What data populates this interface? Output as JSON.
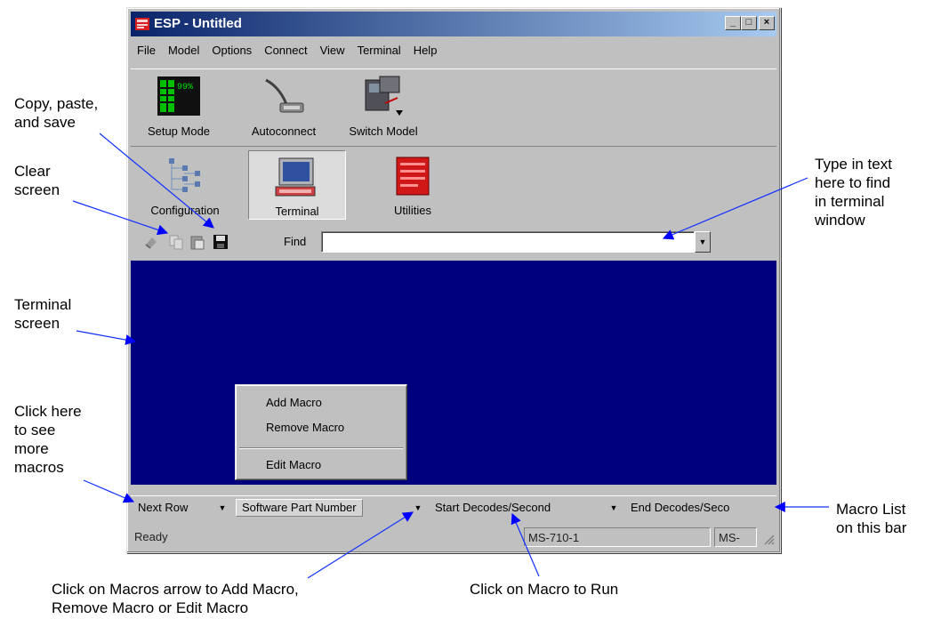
{
  "window": {
    "title": "ESP - Untitled",
    "controls": [
      "_",
      "□",
      "×"
    ]
  },
  "menu": [
    "File",
    "Model",
    "Options",
    "Connect",
    "View",
    "Terminal",
    "Help"
  ],
  "toolbar": {
    "setup_mode": "Setup Mode",
    "setup_mode_display": "99%",
    "autoconnect": "Autoconnect",
    "switch_model": "Switch Model"
  },
  "tabs": {
    "configuration": "Configuration",
    "terminal": "Terminal",
    "utilities": "Utilities"
  },
  "find": {
    "label": "Find",
    "value": ""
  },
  "context_menu": {
    "add": "Add Macro",
    "remove": "Remove Macro",
    "edit": "Edit Macro"
  },
  "macros": [
    "Next Row",
    "Software Part Number",
    "Start Decodes/Second",
    "End Decodes/Seco"
  ],
  "status": {
    "text": "Ready",
    "model": "MS-710-1",
    "short": "MS-"
  },
  "callouts": {
    "copy_paste_save": "Copy, paste,\nand save",
    "clear_screen": "Clear\nscreen",
    "terminal_screen": "Terminal\nscreen",
    "more_macros": "Click here\nto see\nmore\nmacros",
    "find_text": "Type in text\nhere to find\nin terminal\nwindow",
    "macro_list": "Macro List\non this bar",
    "macros_arrow": "Click on Macros arrow to Add Macro,\nRemove Macro or Edit Macro",
    "run_macro": "Click on Macro to Run"
  },
  "colors": {
    "terminal_bg": "#00007f",
    "titlebar": "#0a246a",
    "window_face": "#c0c0c0",
    "arrow": "#0000ff"
  }
}
